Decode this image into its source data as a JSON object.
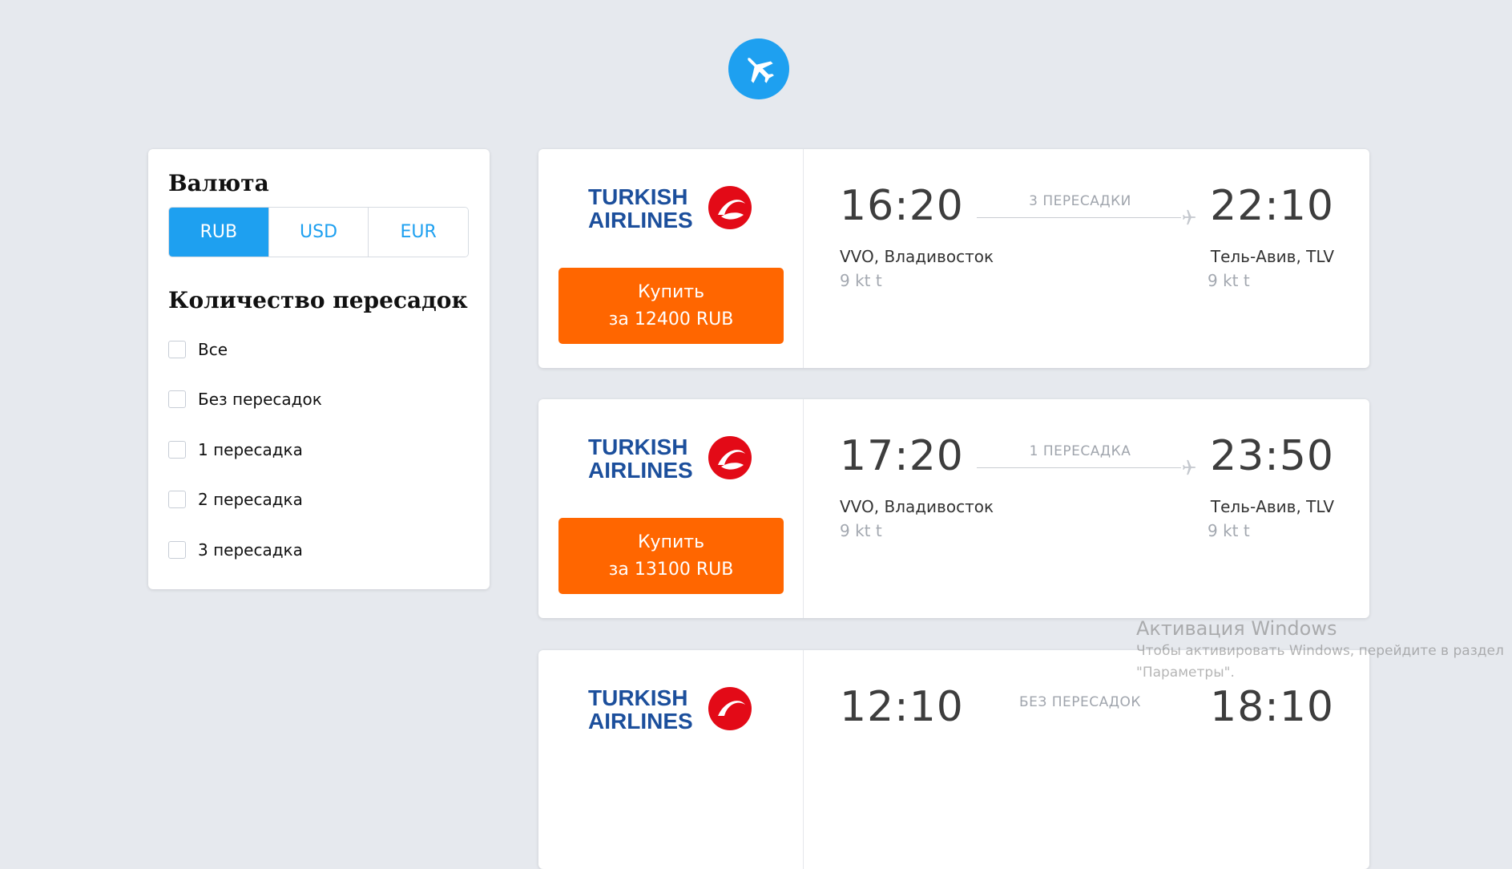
{
  "header": {
    "logo_icon": "airplane-icon",
    "brand_color": "#1ea0f0"
  },
  "filters": {
    "currency_title": "Валюта",
    "currencies": [
      {
        "label": "RUB",
        "active": true
      },
      {
        "label": "USD",
        "active": false
      },
      {
        "label": "EUR",
        "active": false
      }
    ],
    "stops_title": "Количество пересадок",
    "stops": [
      {
        "label": "Все",
        "checked": false
      },
      {
        "label": "Без пересадок",
        "checked": false
      },
      {
        "label": "1 пересадка",
        "checked": false
      },
      {
        "label": "2 пересадка",
        "checked": false
      },
      {
        "label": "3 пересадка",
        "checked": false
      }
    ]
  },
  "tickets": [
    {
      "airline": "Turkish Airlines",
      "airline_logo_line1": "TURKISH",
      "airline_logo_line2": "AIRLINES",
      "buy_line1": "Купить",
      "buy_line2": "за 12400 RUB",
      "departure_time": "16:20",
      "arrival_time": "22:10",
      "stops": "3 ПЕРЕСАДКИ",
      "origin": "VVO, Владивосток",
      "destination": "Тель-Авив, TLV",
      "departure_date": "9 kt t",
      "arrival_date": "9 kt t"
    },
    {
      "airline": "Turkish Airlines",
      "airline_logo_line1": "TURKISH",
      "airline_logo_line2": "AIRLINES",
      "buy_line1": "Купить",
      "buy_line2": "за 13100 RUB",
      "departure_time": "17:20",
      "arrival_time": "23:50",
      "stops": "1 ПЕРЕСАДКА",
      "origin": "VVO, Владивосток",
      "destination": "Тель-Авив, TLV",
      "departure_date": "9 kt t",
      "arrival_date": "9 kt t"
    },
    {
      "airline": "Turkish Airlines",
      "airline_logo_line1": "TURKISH",
      "airline_logo_line2": "AIRLINES",
      "departure_time": "12:10",
      "arrival_time": "18:10",
      "stops": "БЕЗ ПЕРЕСАДОК"
    }
  ],
  "colors": {
    "background": "#e6e9ee",
    "accent": "#1ea0f0",
    "buy_button": "#ff6600",
    "airline_blue": "#1c4f9c",
    "airline_red": "#e30a17"
  },
  "watermark": {
    "title": "Активация Windows",
    "line1": "Чтобы активировать Windows, перейдите в раздел",
    "line2": "\"Параметры\"."
  }
}
